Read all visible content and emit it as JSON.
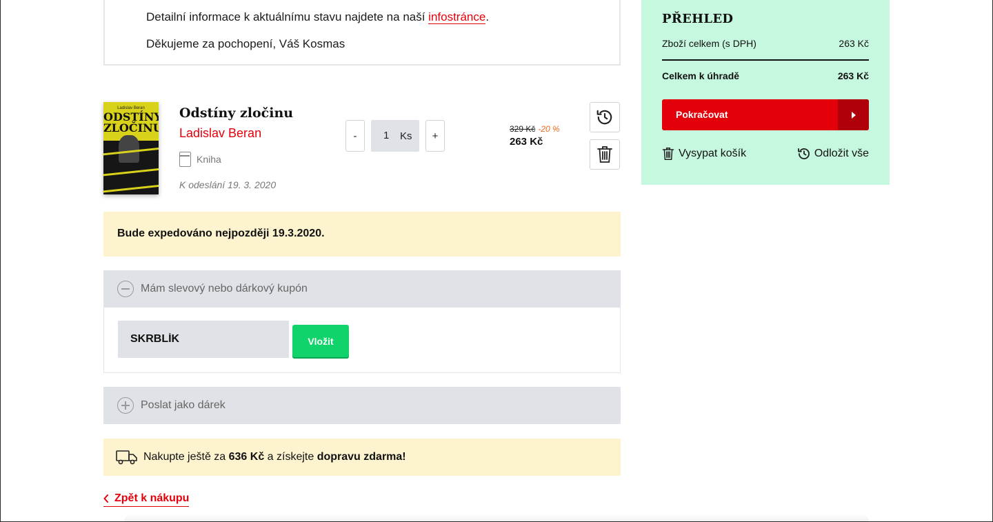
{
  "notice": {
    "line1_prefix": "Detailní informace k aktuálnímu stavu najdete na naší ",
    "line1_link": "infostránce",
    "line1_suffix": ".",
    "line2": "Děkujeme za pochopení, Váš Kosmas"
  },
  "item": {
    "cover_author": "Ladislav Beran",
    "cover_title_1": "ODSTÍNY",
    "cover_title_2": "ZLOČINU",
    "title": "Odstíny zločinu",
    "author": "Ladislav Beran",
    "type": "Kniha",
    "shipping": "K odeslání 19. 3. 2020",
    "qty_minus": "-",
    "qty_value": "1",
    "qty_unit": "Ks",
    "qty_plus": "+",
    "price_old": "329 Kč",
    "discount": "-20 %",
    "price_new": "263 Kč"
  },
  "expedite": {
    "text": "Bude expedováno nejpozději 19.3.2020."
  },
  "coupon": {
    "label": "Mám slevový nebo dárkový kupón",
    "value": "SKRBLÍK",
    "button": "Vložit"
  },
  "gift": {
    "label": "Poslat jako dárek"
  },
  "shipping_banner": {
    "prefix": "Nakupte ještě za ",
    "amount": "636 Kč",
    "middle": " a získejte ",
    "bold": "dopravu zdarma!"
  },
  "back": {
    "label": "Zpět k nákupu"
  },
  "summary": {
    "title": "PŘEHLED",
    "goods_label": "Zboží celkem (s DPH)",
    "goods_value": "263 Kč",
    "total_label": "Celkem k úhradě",
    "total_value": "263 Kč",
    "continue": "Pokračovat",
    "empty_cart": "Vysypat košík",
    "defer_all": "Odložit vše"
  },
  "colors": {
    "accent_red": "#e4000b",
    "summary_bg": "#c6f7df",
    "banner_bg": "#fdf4cf",
    "coupon_button": "#10d36b"
  }
}
